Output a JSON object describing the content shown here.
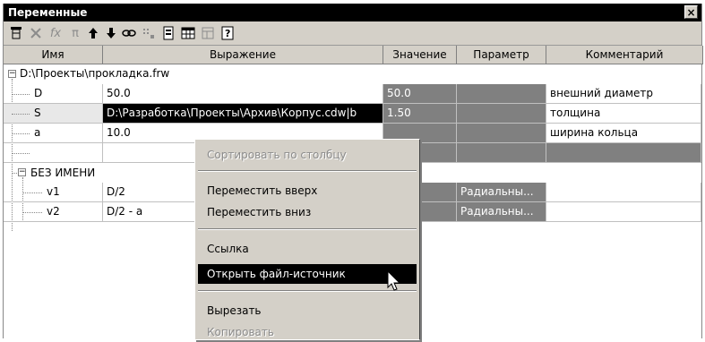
{
  "window": {
    "title": "Переменные",
    "close_label": "×"
  },
  "toolbar": {
    "icons": [
      "table-icon",
      "delete-icon",
      "function-icon",
      "pi-icon",
      "arrow-up-icon",
      "arrow-down-icon",
      "link-icon",
      "grid-dots-icon",
      "file-icon",
      "table-grid-icon",
      "export-icon",
      "help-icon"
    ]
  },
  "columns": [
    "Имя",
    "Выражение",
    "Значение",
    "Параметр",
    "Комментарий"
  ],
  "tree": {
    "file_row": "D:\\Проекты\\прокладка.frw",
    "group_row": "БЕЗ ИМЕНИ"
  },
  "rows": [
    {
      "name": "D",
      "expr": "50.0",
      "value": "50.0",
      "param": "",
      "comment": "внешний диаметр"
    },
    {
      "name": "S",
      "expr": "D:\\Разработка\\Проекты\\Архив\\Корпус.cdw|b",
      "value": "1.50",
      "param": "",
      "comment": "толщина"
    },
    {
      "name": "a",
      "expr": "10.0",
      "value": "",
      "param": "",
      "comment": "ширина кольца"
    },
    {
      "name": "",
      "expr": "",
      "value": "",
      "param": "",
      "comment": ""
    },
    {
      "name": "v1",
      "expr": "D/2",
      "value": "",
      "param": "Радиальны...",
      "comment": ""
    },
    {
      "name": "v2",
      "expr": "D/2 - a",
      "value": "",
      "param": "Радиальны...",
      "comment": ""
    }
  ],
  "context_menu": {
    "sort": "Сортировать по столбцу",
    "move_up": "Переместить вверх",
    "move_down": "Переместить вниз",
    "link": "Ссылка",
    "open_source": "Открыть файл-источник",
    "cut": "Вырезать",
    "copy": "Копировать"
  }
}
